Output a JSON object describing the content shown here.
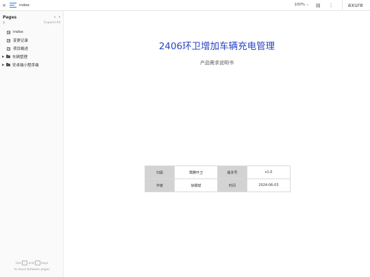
{
  "topbar": {
    "close_glyph": "×",
    "page_name": "index",
    "zoom": "100% ⌵",
    "brand": "axure"
  },
  "sidebar": {
    "title": "Pages",
    "prev_glyph": "‹",
    "next_glyph": "›",
    "search_glyph": "⚲",
    "expand_all": "Expand All",
    "pages": [
      {
        "label": "index"
      },
      {
        "label": "变更记录"
      },
      {
        "label": "项目概述"
      }
    ],
    "folders": [
      {
        "label": "车辆管理"
      },
      {
        "label": "安卓端小程序端"
      }
    ],
    "hint": {
      "use": "Use",
      "and": "and",
      "keys": "keys",
      "line2": "to move between pages",
      "prev_key": "‹",
      "next_key": "›"
    }
  },
  "document": {
    "title": "2406环卫增加车辆充电管理",
    "subtitle": "产品需求说明书",
    "meta": {
      "owner_label": "归属",
      "owner_value": "鹭腾环卫",
      "version_label": "版本号",
      "version_value": "v1.0",
      "author_label": "作者",
      "author_value": "徐娜斌",
      "time_label": "时间",
      "time_value": "2024-06-03"
    }
  },
  "colors": {
    "title_blue": "#2a43c4",
    "menu_icon_blue": "#1976d2",
    "table_label_bg": "#d3d3d3"
  }
}
